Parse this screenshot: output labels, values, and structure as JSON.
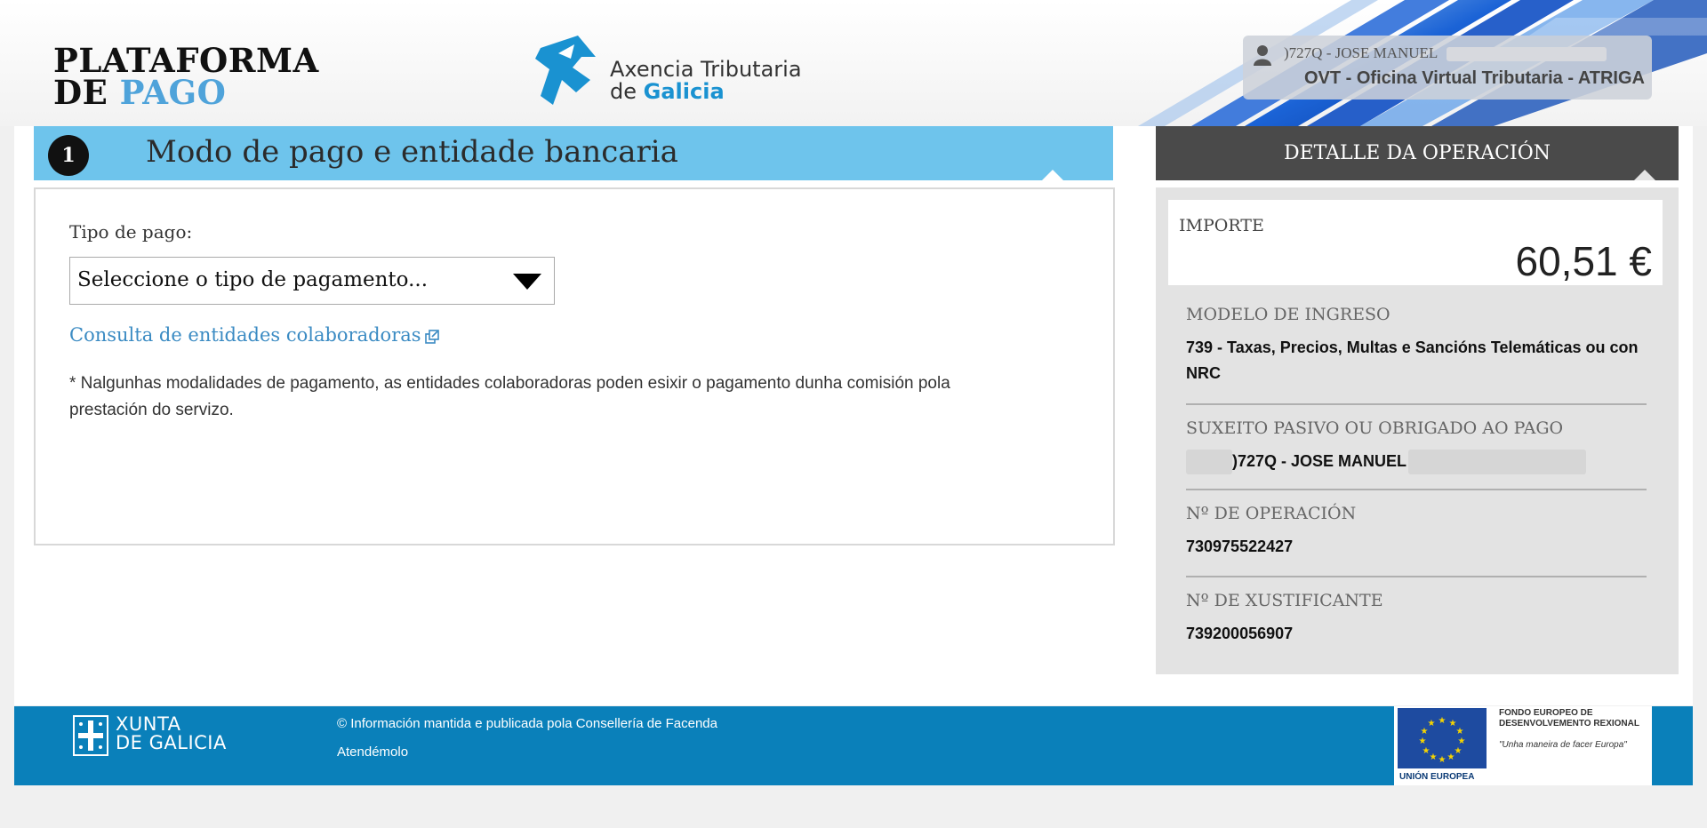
{
  "header": {
    "brand_line1": "PLATAFORMA",
    "brand_line2_a": "DE ",
    "brand_line2_b": "PAGO",
    "agency_line1": "Axencia Tributaria",
    "agency_line2_a": "de ",
    "agency_line2_b": "Galicia",
    "user_name": ")727Q - JOSE MANUEL",
    "user_app": "OVT - Oficina Virtual Tributaria - ATRIGA"
  },
  "step": {
    "number": "1",
    "title": "Modo de pago e entidade bancaria",
    "tipo_label": "Tipo de pago:",
    "tipo_select_value": "Seleccione o tipo de pagamento...",
    "consulta_link": "Consulta de entidades colaboradoras",
    "note": "* Nalgunhas modalidades de pagamento, as entidades colaboradoras poden esixir o pagamento dunha comisión pola prestación do servizo."
  },
  "sidebar": {
    "title": "DETALLE DA OPERACIÓN",
    "importe_label": "IMPORTE",
    "importe_value": "60,51 €",
    "modelo_label": "MODELO DE INGRESO",
    "modelo_value": "739 - Taxas, Precios, Multas e Sancións Telemáticas ou con NRC",
    "suxeito_label": "SUXEITO PASIVO OU OBRIGADO AO PAGO",
    "suxeito_value": ")727Q - JOSE MANUEL",
    "operacion_label": "Nº DE OPERACIÓN",
    "operacion_value": "730975522427",
    "xustificante_label": "Nº DE XUSTIFICANTE",
    "xustificante_value": "739200056907"
  },
  "footer": {
    "xunta_line1": "XUNTA",
    "xunta_line2": "DE GALICIA",
    "info": "© Información mantida e publicada pola Consellería de Facenda",
    "link": "Atendémolo",
    "eu_text": "FONDO EUROPEO DE DESENVOLVEMENTO REXIONAL",
    "eu_quote": "\"Unha maneira de facer Europa\"",
    "eu_caption": "UNIÓN EUROPEA"
  },
  "colors": {
    "step_header": "#6ec4ec",
    "side_header": "#4a4a4a",
    "footer": "#0a80ba",
    "link": "#3b8bc3"
  },
  "icons": [
    "user-icon",
    "external-link-icon",
    "dropdown-caret-icon",
    "atriga-logo-icon",
    "xunta-logo-icon",
    "eu-flag-icon"
  ]
}
